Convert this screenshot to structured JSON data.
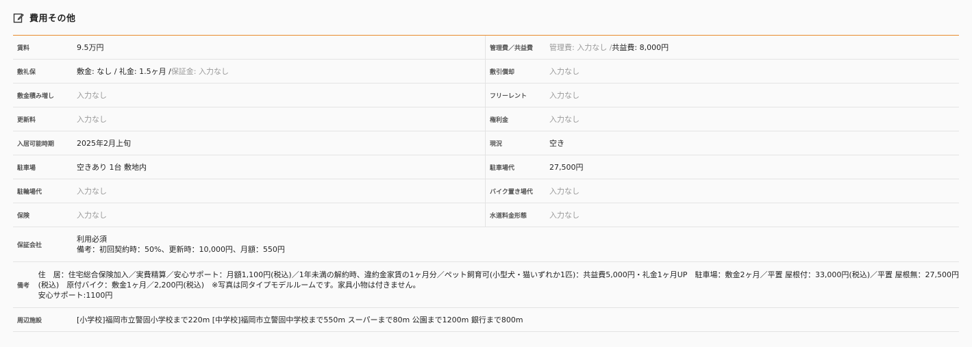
{
  "section": {
    "title": "費用その他",
    "icon": "note-edit-icon"
  },
  "colors": {
    "accent": "#e88a2b",
    "muted": "#999999"
  },
  "rows2": [
    {
      "l_label": "賃料",
      "l_value": "9.5万円",
      "r_label": "管理費／共益費",
      "r_prefix": "管理費: 入力なし / ",
      "r_value": "共益費: 8,000円"
    },
    {
      "l_label": "敷礼保",
      "l_prefix": "",
      "l_value": "敷金: なし / 礼金: 1.5ヶ月 / ",
      "l_suffix": "保証金: 入力なし",
      "r_label": "敷引償却",
      "r_empty": "入力なし"
    },
    {
      "l_label": "敷金積み増し",
      "l_empty": "入力なし",
      "r_label": "フリーレント",
      "r_empty": "入力なし"
    },
    {
      "l_label": "更新料",
      "l_empty": "入力なし",
      "r_label": "権利金",
      "r_empty": "入力なし"
    },
    {
      "l_label": "入居可能時期",
      "l_value": "2025年2月上旬",
      "r_label": "現況",
      "r_value": "空き"
    },
    {
      "l_label": "駐車場",
      "l_value": "空きあり 1台 敷地内",
      "r_label": "駐車場代",
      "r_value": "27,500円"
    },
    {
      "l_label": "駐輪場代",
      "l_empty": "入力なし",
      "r_label": "バイク置き場代",
      "r_empty": "入力なし"
    },
    {
      "l_label": "保険",
      "l_empty": "入力なし",
      "r_label": "水道料金形態",
      "r_empty": "入力なし"
    }
  ],
  "guarantee": {
    "label": "保証会社",
    "line1": "利用必須",
    "line2": "備考：初回契約時：50%、更新時：10,000円、月額：550円"
  },
  "notes": {
    "label": "備考",
    "line1": "住　居：住宅総合保険加入／実費精算／安心サポート：月額1,100円(税込)／1年未満の解約時、違約金家賃の1ヶ月分／ペット飼育可(小型犬・猫いずれか1匹)：共益費5,000円・礼金1ヶ月UP　駐車場：敷金2ヶ月／平置 屋根付：33,000円(税込)／平置 屋根無：27,500円",
    "line2": "(税込)　原付バイク：敷金1ヶ月／2,200円(税込)　※写真は同タイプモデルルームです。家具小物は付きません。",
    "line3": "安心サポート:1100円"
  },
  "nearby": {
    "label": "周辺施設",
    "value": "[小学校]福岡市立警固小学校まで220m [中学校]福岡市立警固中学校まで550m スーパーまで80m 公園まで1200m 銀行まで800m"
  }
}
